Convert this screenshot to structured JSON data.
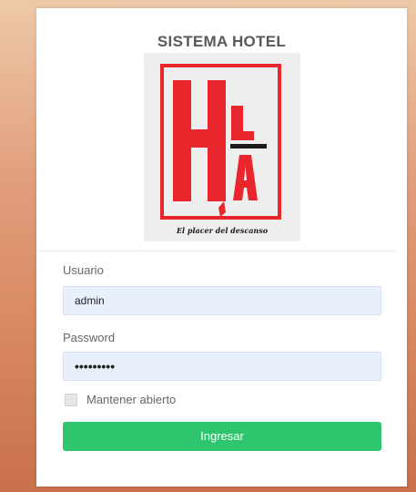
{
  "login": {
    "title": "SISTEMA HOTEL",
    "logo": {
      "letters": "HLA",
      "tagline": "El placer del descanso",
      "colors": {
        "red": "#e8262c",
        "dark": "#1a1a1a"
      }
    },
    "username": {
      "label": "Usuario",
      "value": "admin"
    },
    "password": {
      "label": "Password",
      "value": "•••••••••"
    },
    "remember": {
      "label": "Mantener abierto",
      "checked": false
    },
    "submit_label": "Ingresar",
    "colors": {
      "button": "#2fc56f",
      "input_bg": "#e8f0fe"
    }
  }
}
